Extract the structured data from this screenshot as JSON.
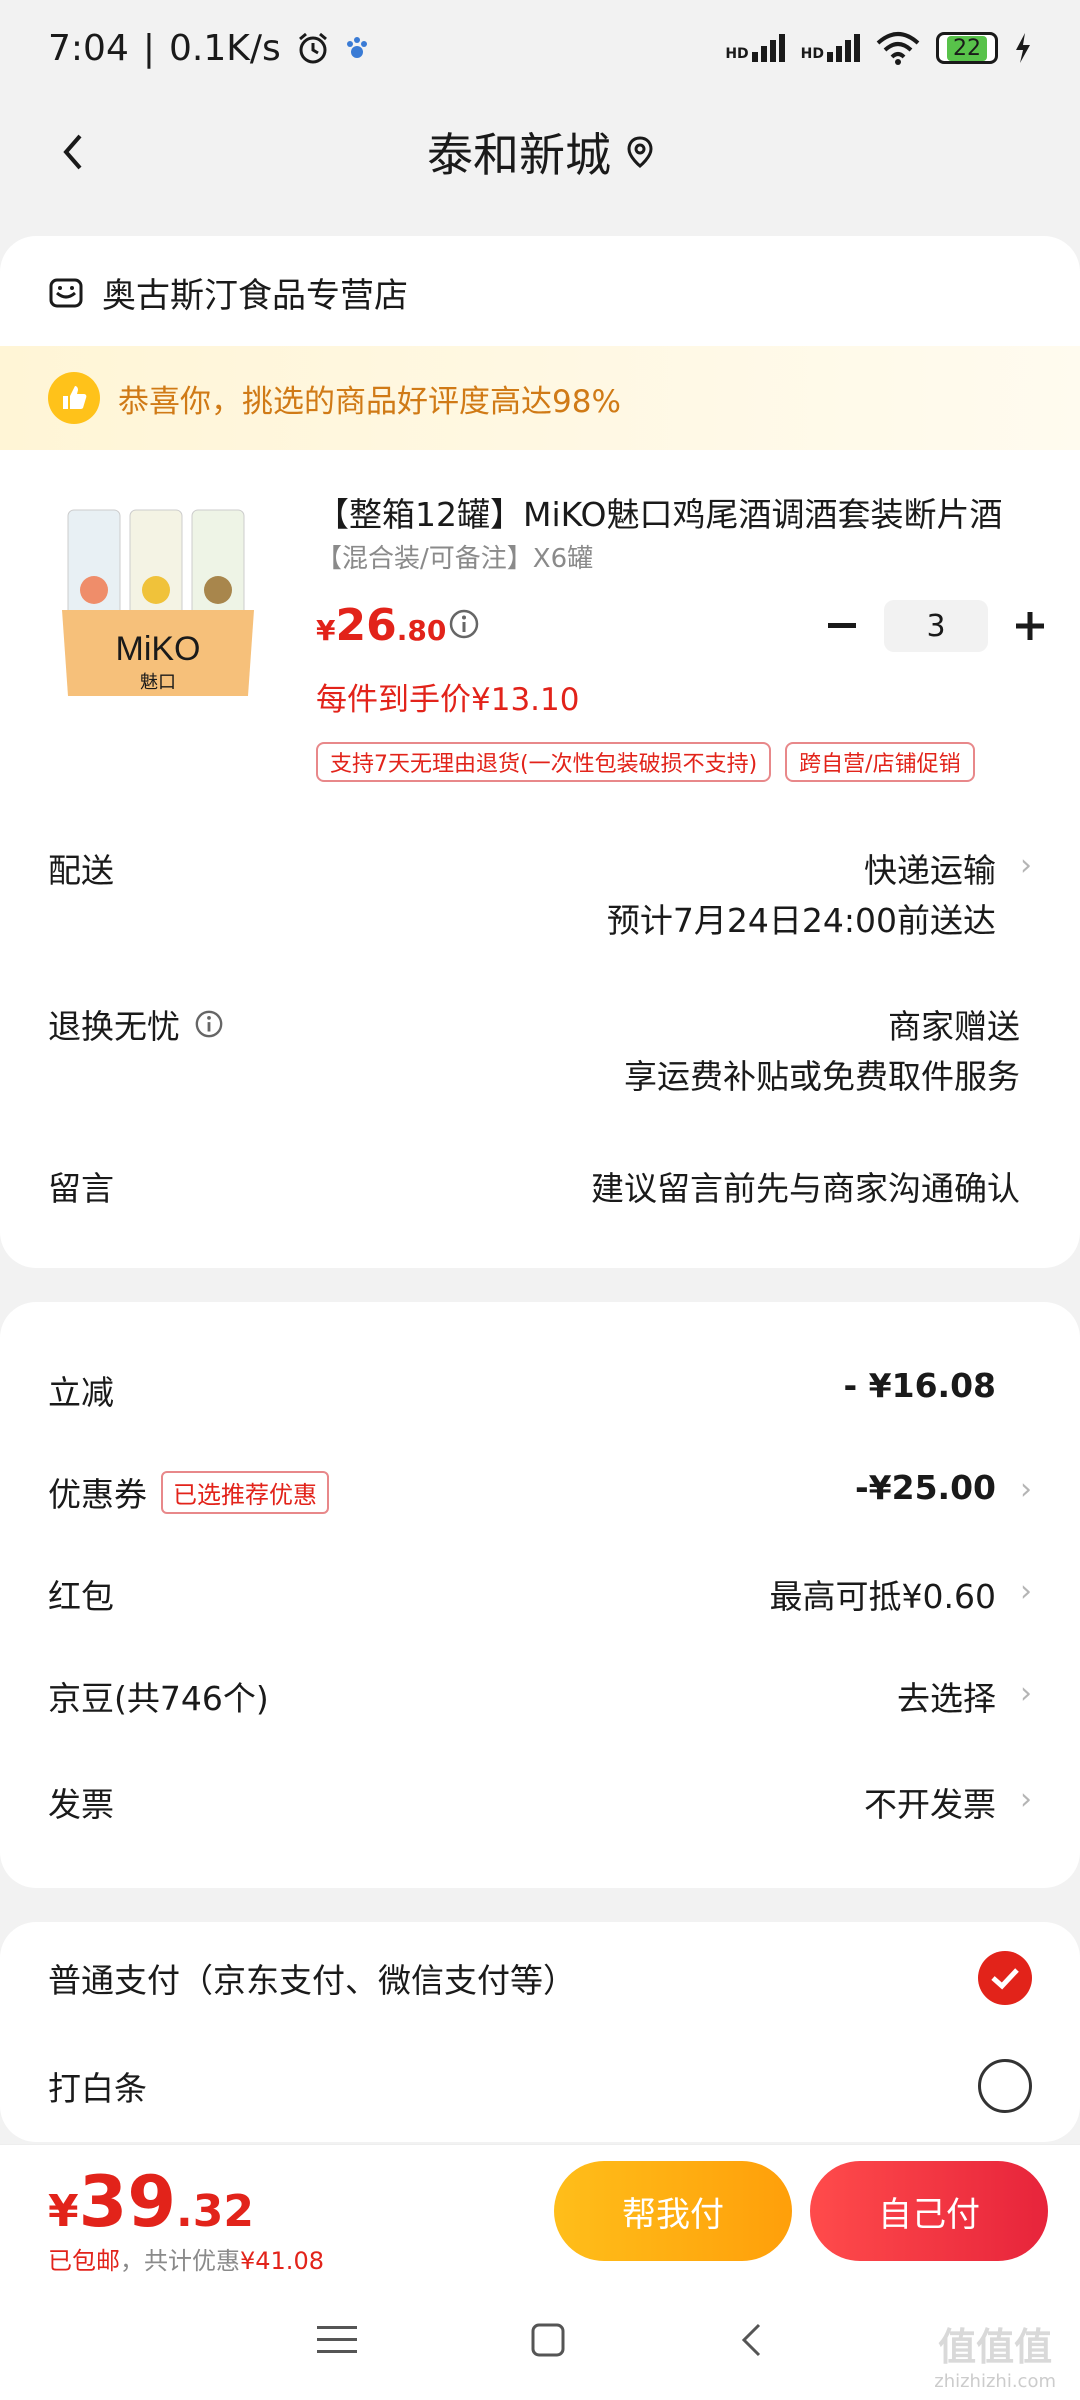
{
  "status_bar": {
    "time": "7:04",
    "net_speed": "0.1K/s",
    "battery": "22",
    "hd1": "HD",
    "hd2": "HD"
  },
  "header": {
    "title": "泰和新城"
  },
  "store": {
    "name": "奥古斯汀食品专营店"
  },
  "praise": {
    "text": "恭喜你，挑选的商品好评度高达98%"
  },
  "product": {
    "title": "【整箱12罐】MiKO魅口鸡尾酒调酒套装断片酒",
    "spec": "【混合装/可备注】X6罐",
    "price_symbol": "¥",
    "price_int": "26",
    "price_dec": ".80",
    "hand_price": "每件到手价¥13.10",
    "quantity": "3",
    "brand_label": "MiKO",
    "brand_cn": "魅口",
    "tags": [
      "支持7天无理由退货(一次性包装破损不支持)",
      "跨自营/店铺促销"
    ]
  },
  "delivery": {
    "label": "配送",
    "value": "快递运输",
    "eta": "预计7月24日24:00前送达"
  },
  "returns": {
    "label": "退换无忧",
    "value": "商家赠送",
    "detail": "享运费补贴或免费取件服务"
  },
  "message": {
    "label": "留言",
    "placeholder": "建议留言前先与商家沟通确认"
  },
  "discounts": {
    "instant": {
      "label": "立减",
      "value": "- ¥16.08"
    },
    "coupon": {
      "label": "优惠券",
      "tag": "已选推荐优惠",
      "value": "-¥25.00"
    },
    "redpacket": {
      "label": "红包",
      "value": "最高可抵¥0.60"
    },
    "jd_beans": {
      "label": "京豆(共746个)",
      "value": "去选择"
    },
    "invoice": {
      "label": "发票",
      "value": "不开发票"
    }
  },
  "payment": {
    "normal": {
      "label": "普通支付（京东支付、微信支付等）",
      "checked": true
    },
    "baitiao": {
      "label": "打白条",
      "checked": false
    }
  },
  "bottom": {
    "total_symbol": "¥",
    "total_int": "39",
    "total_dec": ".32",
    "shipping": "已包邮",
    "savings_label": "，共计优惠",
    "savings": "¥41.08",
    "help_pay": "帮我付",
    "self_pay": "自己付"
  },
  "watermark": {
    "big": "值值值",
    "url": "zhizhizhi.com"
  },
  "colors": {
    "accent": "#e2231a",
    "praise_text": "#d07a16",
    "help_btn": "#ffb014"
  }
}
